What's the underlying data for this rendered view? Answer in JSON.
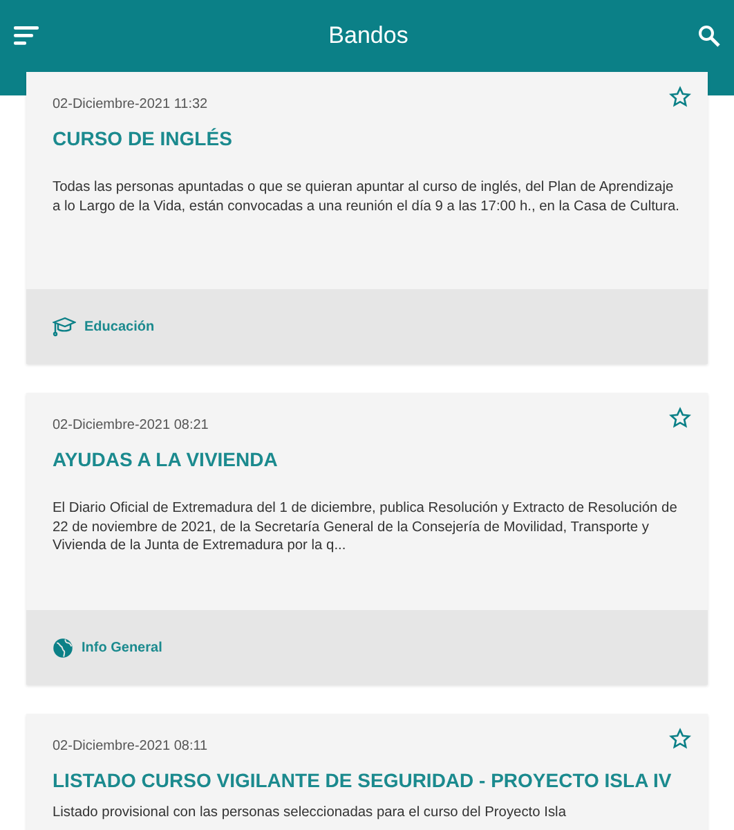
{
  "app_bar": {
    "title": "Bandos"
  },
  "posts": [
    {
      "date": "02-Diciembre-2021 11:32",
      "title": "CURSO DE INGLÉS",
      "body": "Todas las personas apuntadas o que se quieran apuntar al curso de inglés, del Plan de Aprendizaje a lo Largo de la Vida, están convocadas a una reunión el día 9 a las 17:00 h., en la Casa de Cultura.",
      "starred": false,
      "category": {
        "kind": "education",
        "label": "Educación"
      }
    },
    {
      "date": "02-Diciembre-2021 08:21",
      "title": "AYUDAS A LA VIVIENDA",
      "body": "El Diario Oficial de Extremadura del 1 de diciembre, publica Resolución y Extracto de Resolución de  22 de noviembre de 2021, de la Secretaría General de la Consejería de Movilidad, Transporte y Vivienda de la Junta de Extremadura por la q...",
      "starred": false,
      "category": {
        "kind": "general",
        "label": "Info General"
      }
    },
    {
      "date": "02-Diciembre-2021 08:11",
      "title": "LISTADO CURSO VIGILANTE DE SEGURIDAD - PROYECTO ISLA IV",
      "body": "Listado provisional con las personas seleccionadas para el curso del Proyecto Isla",
      "starred": false
    }
  ]
}
